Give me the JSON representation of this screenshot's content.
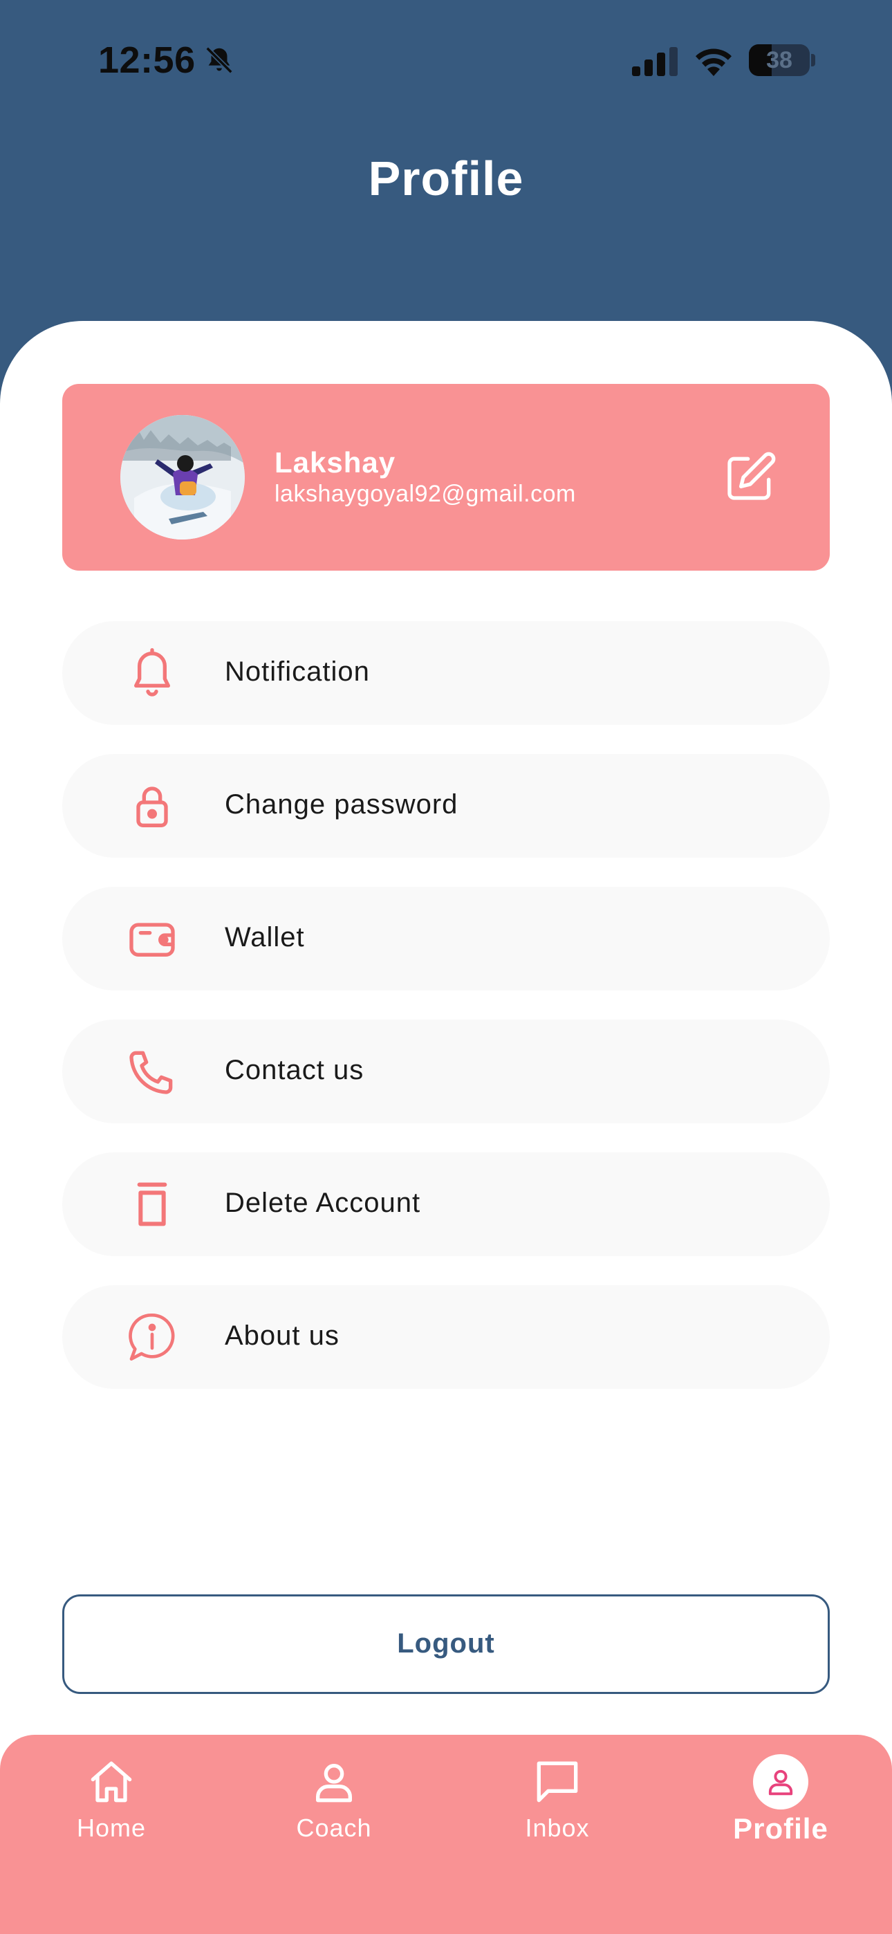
{
  "status_bar": {
    "time": "12:56",
    "battery": "38",
    "battery_level": 0.38
  },
  "header": {
    "title": "Profile"
  },
  "profile": {
    "name": "Lakshay",
    "email": "lakshaygoyal92@gmail.com"
  },
  "menu": {
    "items": [
      {
        "label": "Notification",
        "icon": "bell-icon"
      },
      {
        "label": "Change password",
        "icon": "lock-icon"
      },
      {
        "label": "Wallet",
        "icon": "wallet-icon"
      },
      {
        "label": "Contact us",
        "icon": "phone-icon"
      },
      {
        "label": "Delete Account",
        "icon": "trash-icon"
      },
      {
        "label": "About us",
        "icon": "info-bubble-icon"
      }
    ]
  },
  "logout": {
    "label": "Logout"
  },
  "bottom_nav": {
    "items": [
      {
        "label": "Home",
        "icon": "home-icon",
        "active": false
      },
      {
        "label": "Coach",
        "icon": "person-icon",
        "active": false
      },
      {
        "label": "Inbox",
        "icon": "chat-icon",
        "active": false
      },
      {
        "label": "Profile",
        "icon": "person-icon",
        "active": true
      }
    ]
  },
  "colors": {
    "header_bg": "#375a7f",
    "accent": "#f99294",
    "icon_accent": "#f37779",
    "menu_item_bg": "#f9f9f9",
    "active_nav_icon": "#e8427c"
  }
}
